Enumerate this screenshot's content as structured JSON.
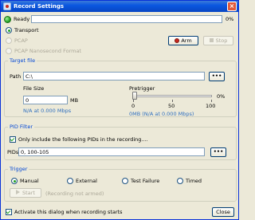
{
  "window": {
    "title": "Record Settings",
    "close_glyph": "×"
  },
  "status": {
    "ready_label": "Ready",
    "progress_percent": 0,
    "progress_text": "0%"
  },
  "mode": {
    "options": [
      "Transport",
      "PCAP",
      "PCAP Nanosecond Format"
    ],
    "selected": "Transport"
  },
  "buttons": {
    "arm": "Arm",
    "stop": "Stop",
    "browse": "•••",
    "pid_browse": "•••",
    "start": "Start",
    "close": "Close"
  },
  "target_file": {
    "group_title": "Target file",
    "path_label": "Path",
    "path_value": "C:\\",
    "file_size_label": "File Size",
    "file_size_value": "0",
    "file_size_unit": "MB",
    "file_size_rate": "N/A at 0.000 Mbps",
    "pretrigger_label": "Pretrigger",
    "pretrigger_percent": 0,
    "pretrigger_percent_text": "0%",
    "pretrigger_ticks": [
      "0",
      "50",
      "100"
    ],
    "pretrigger_rate": "0MB (N/A at 0.000 Mbps)"
  },
  "pid_filter": {
    "group_title": "PID Filter",
    "checkbox_label": "Only include the following PIDs in the recording....",
    "checkbox_checked": true,
    "pids_label": "PIDs",
    "pids_value": "0, 100-105"
  },
  "trigger": {
    "group_title": "Trigger",
    "options": [
      "Manual",
      "External",
      "Test Failure",
      "Timed"
    ],
    "selected": "Manual",
    "status_text": "(Recording not armed)"
  },
  "footer": {
    "activate_label": "Activate this dialog when recording starts",
    "activate_checked": true
  },
  "colors": {
    "accent": "#0a57e0",
    "group_title": "#0046d5",
    "ready_led": "#1a9a1a",
    "arm_dot": "#c8271f"
  }
}
